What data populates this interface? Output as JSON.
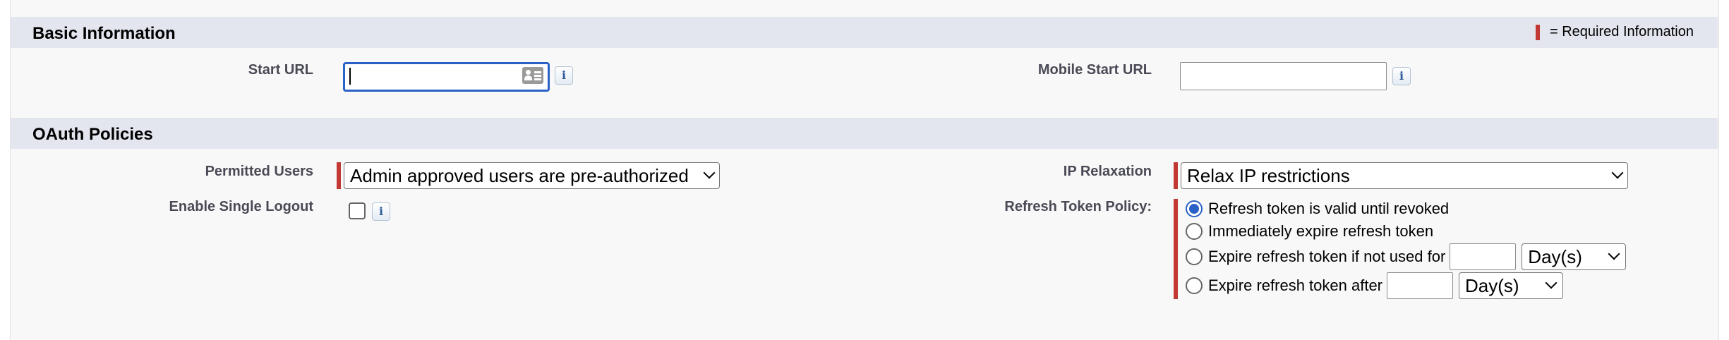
{
  "basic_info": {
    "title": "Basic Information",
    "required_legend": "= Required Information",
    "start_url": {
      "label": "Start URL",
      "value": ""
    },
    "mobile_start_url": {
      "label": "Mobile Start URL",
      "value": ""
    },
    "info_icon_glyph": "i"
  },
  "oauth_policies": {
    "title": "OAuth Policies",
    "permitted_users": {
      "label": "Permitted Users",
      "selected": "Admin approved users are pre-authorized"
    },
    "ip_relaxation": {
      "label": "IP Relaxation",
      "selected": "Relax IP restrictions"
    },
    "enable_single_logout": {
      "label": "Enable Single Logout",
      "checked": false
    },
    "refresh_token_policy": {
      "label": "Refresh Token Policy:",
      "selected_index": 0,
      "options": [
        "Refresh token is valid until revoked",
        "Immediately expire refresh token",
        "Expire refresh token if not used for",
        "Expire refresh token after"
      ],
      "unused_for_value": "",
      "unused_for_unit": "Day(s)",
      "after_value": "",
      "after_unit": "Day(s)"
    }
  },
  "colors": {
    "section_header_bg": "#e3e6ee",
    "required_red": "#c23934",
    "focus_blue": "#2a61c6"
  }
}
